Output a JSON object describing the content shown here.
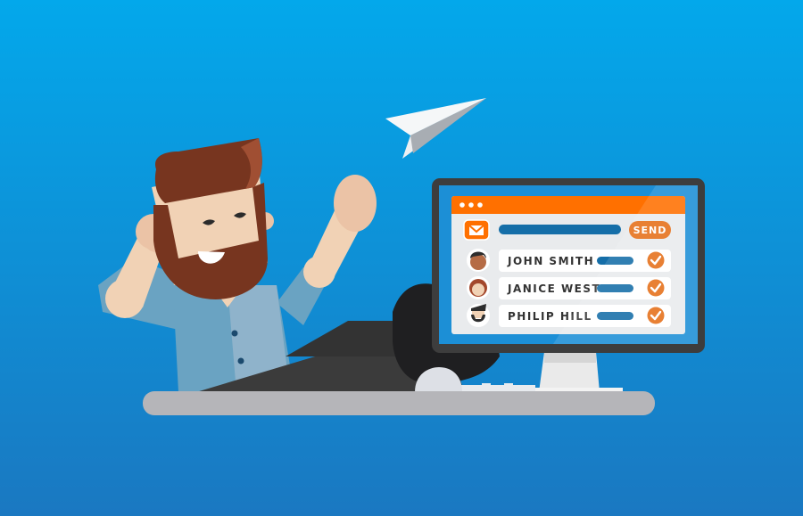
{
  "scene": {
    "description": "Bearded man celebrating at a desk while a paper plane flies away from a computer showing a sent email",
    "colors": {
      "background_top": "#03a8eb",
      "background_bottom": "#1a78c1",
      "accent_orange": "#ff7000",
      "bar_blue": "#156ea8",
      "monitor_frame": "#3d3d3d",
      "hair_beard": "#77351f",
      "skin": "#f1d2b5",
      "shirt": "#6aa3c2",
      "desk": "#b5b5b9"
    }
  },
  "email_window": {
    "window_dots_icon": "three-dots-icon",
    "mail_icon": "envelope-icon",
    "send_button_label": "SEND",
    "recipients": [
      {
        "name": "JOHN SMITH",
        "avatar": "man-avatar-dark-hair",
        "status_icon": "check-circle-icon",
        "sent": true
      },
      {
        "name": "JANICE WEST",
        "avatar": "woman-avatar-red-hair",
        "status_icon": "check-circle-icon",
        "sent": true
      },
      {
        "name": "PHILIP HILL",
        "avatar": "man-avatar-beard",
        "status_icon": "check-circle-icon",
        "sent": true
      }
    ]
  },
  "paper_plane_icon": "paper-plane-icon"
}
